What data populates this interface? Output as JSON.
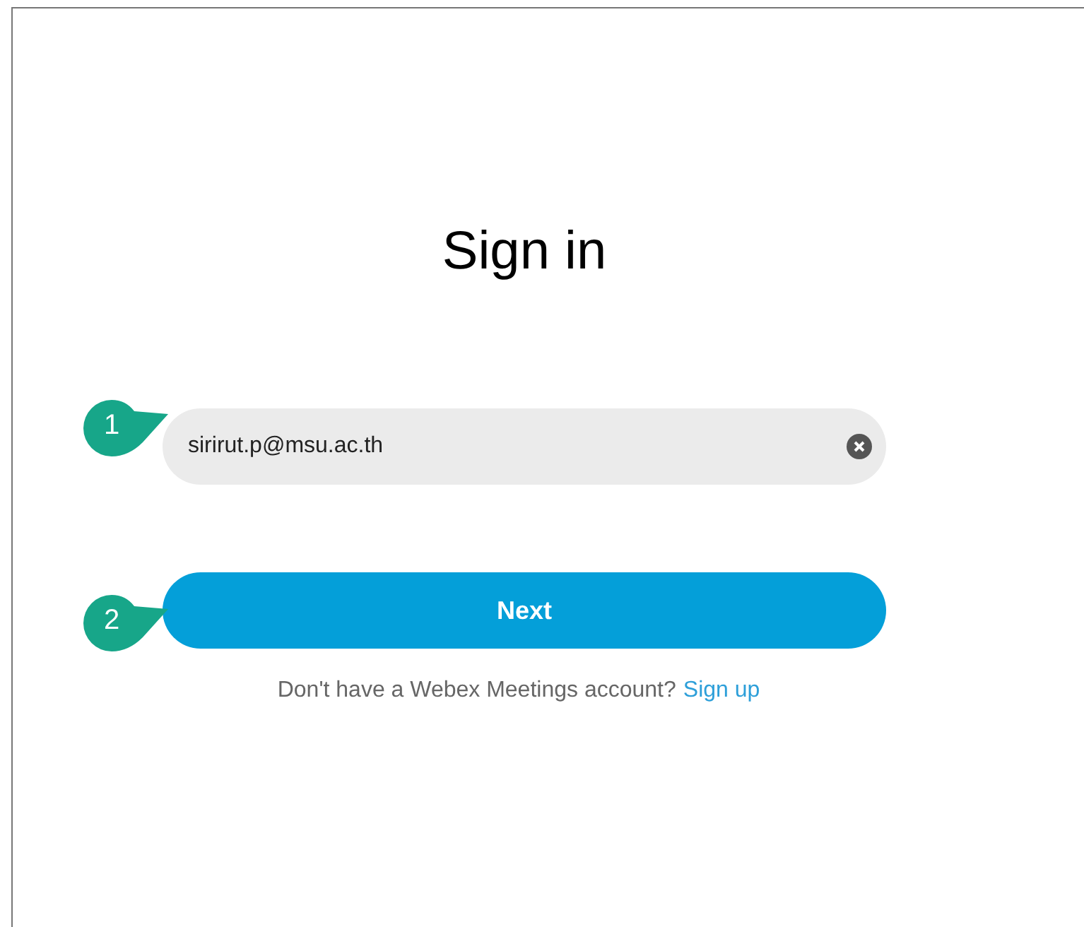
{
  "title": "Sign in",
  "email_field": {
    "value": "sirirut.p@msu.ac.th"
  },
  "next_button": {
    "label": "Next"
  },
  "signup_prompt": {
    "text": "Don't have a Webex Meetings account?",
    "link": "Sign up"
  },
  "callouts": [
    {
      "number": "1"
    },
    {
      "number": "2"
    }
  ]
}
